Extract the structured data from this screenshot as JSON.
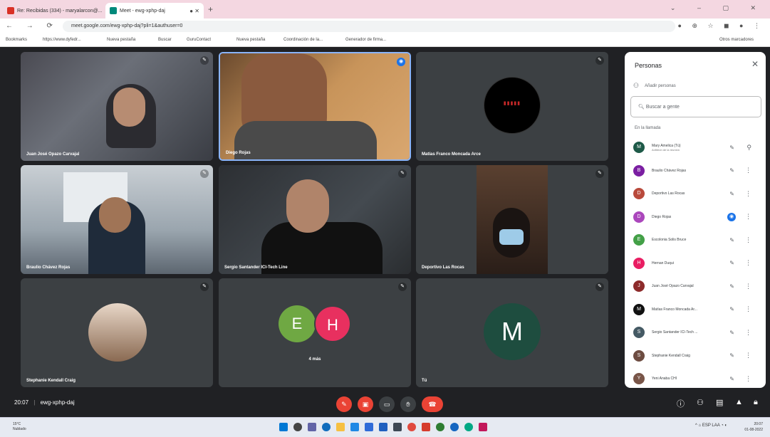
{
  "browser": {
    "tabs": [
      {
        "label": "Re: Recibidas (334) - maryalarcon@...",
        "active": false
      },
      {
        "label": "Meet - ewg-xphp-daj",
        "active": true
      }
    ],
    "url": "meet.google.com/ewg-xphp-daj?pli=1&authuser=0",
    "bookmarks": [
      "Bookmarks",
      "https://www.dyfedr...",
      "Nueva pestaña",
      "Buscar",
      "GuruContact",
      "Nueva pestaña",
      "Coordinación de la...",
      "Generador de firma...",
      "Otros marcadores"
    ]
  },
  "tiles": [
    {
      "name": "Juan José Opazo Carvajal",
      "mic": "off",
      "kind": "video"
    },
    {
      "name": "Diego Rojas",
      "mic": "on",
      "kind": "video"
    },
    {
      "name": "Matías Franco Moncada Arce",
      "mic": "off",
      "kind": "logo"
    },
    {
      "name": "Braulio Chávez Rojas",
      "mic": "off",
      "kind": "video"
    },
    {
      "name": "Sergio Santander ICI-Tech Line",
      "mic": "off",
      "kind": "video"
    },
    {
      "name": "Deportivo Las Rocas",
      "mic": "off",
      "kind": "video"
    },
    {
      "name": "Stephanie Kendall Craig",
      "mic": "off",
      "kind": "photo"
    },
    {
      "name": "4 más",
      "mic": "off",
      "kind": "group",
      "initials": [
        "E",
        "H"
      ]
    },
    {
      "name": "Tú",
      "mic": "off",
      "kind": "avatar",
      "initial": "M"
    }
  ],
  "panel": {
    "title": "Personas",
    "add_people": "Añadir personas",
    "search_placeholder": "Buscar a gente",
    "section": "En la llamada",
    "people": [
      {
        "initial": "M",
        "name": "Mary Amelica (Tú)",
        "sub": "Anfitrión de la reunión",
        "color": "#1e5a48",
        "mic": "off",
        "extra": "pin"
      },
      {
        "initial": "B",
        "name": "Braulio Chávez Rojas",
        "sub": "",
        "color": "#7b1fa2",
        "mic": "off",
        "extra": "more"
      },
      {
        "initial": "D",
        "name": "Deportivo Las Rocas",
        "sub": "",
        "color": "#b94a3c",
        "mic": "off",
        "extra": "more"
      },
      {
        "initial": "D",
        "name": "Diego Rojas",
        "sub": "",
        "color": "#ab47bc",
        "mic": "on",
        "extra": "more"
      },
      {
        "initial": "E",
        "name": "Escolonia Solis Bruce",
        "sub": "",
        "color": "#43a047",
        "mic": "off",
        "extra": "more"
      },
      {
        "initial": "H",
        "name": "Hernan Duqui",
        "sub": "",
        "color": "#e91e63",
        "mic": "off",
        "extra": "more"
      },
      {
        "initial": "J",
        "name": "Juan José Opazo Carvajal",
        "sub": "",
        "color": "#8d2b2b",
        "mic": "off",
        "extra": "more"
      },
      {
        "initial": "M",
        "name": "Matías Franco Moncada Ar...",
        "sub": "",
        "color": "#111111",
        "mic": "off",
        "extra": "more"
      },
      {
        "initial": "S",
        "name": "Sergio Santander ICI-Tech ...",
        "sub": "",
        "color": "#455a64",
        "mic": "off",
        "extra": "more"
      },
      {
        "initial": "S",
        "name": "Stephanie Kendall Craig",
        "sub": "",
        "color": "#6d4c41",
        "mic": "off",
        "extra": "more"
      },
      {
        "initial": "Y",
        "name": "Yeni Anaba CHI",
        "sub": "",
        "color": "#795548",
        "mic": "off",
        "extra": "more"
      }
    ]
  },
  "bottom": {
    "time": "20:07",
    "code": "ewg-xphp-daj"
  },
  "taskbar": {
    "weather_temp": "15°C",
    "weather_desc": "Nublado",
    "lang": "ESP LAA",
    "time": "20:07",
    "date": "01-08-2022"
  }
}
